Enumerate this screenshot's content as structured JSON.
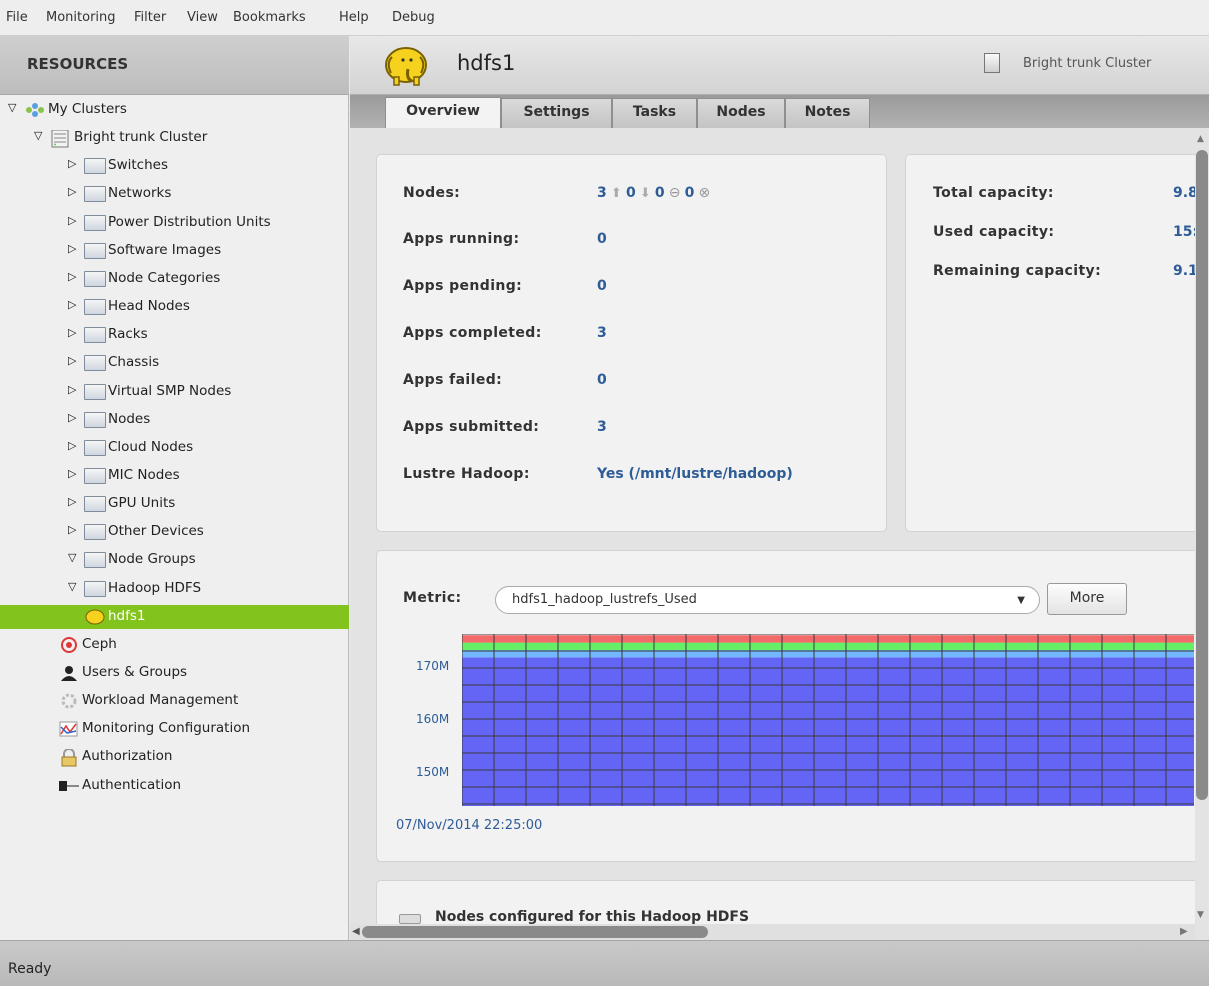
{
  "menu": [
    "File",
    "Monitoring",
    "Filter",
    "View",
    "Bookmarks",
    "Help",
    "Debug"
  ],
  "sidebar": {
    "header": "RESOURCES",
    "tree": [
      {
        "label": "My Clusters",
        "icon": "clusters-icon",
        "toggle": "expanded"
      },
      {
        "label": "Bright trunk Cluster",
        "icon": "cluster-icon",
        "toggle": "expanded"
      },
      {
        "label": "Switches",
        "icon": "folder-icon",
        "toggle": "collapsed"
      },
      {
        "label": "Networks",
        "icon": "folder-icon",
        "toggle": "collapsed"
      },
      {
        "label": "Power Distribution Units",
        "icon": "folder-icon",
        "toggle": "collapsed"
      },
      {
        "label": "Software Images",
        "icon": "folder-icon",
        "toggle": "collapsed"
      },
      {
        "label": "Node Categories",
        "icon": "folder-icon",
        "toggle": "collapsed"
      },
      {
        "label": "Head Nodes",
        "icon": "folder-icon",
        "toggle": "collapsed"
      },
      {
        "label": "Racks",
        "icon": "folder-icon",
        "toggle": "collapsed"
      },
      {
        "label": "Chassis",
        "icon": "folder-icon",
        "toggle": "collapsed"
      },
      {
        "label": "Virtual SMP Nodes",
        "icon": "folder-icon",
        "toggle": "collapsed"
      },
      {
        "label": "Nodes",
        "icon": "folder-icon",
        "toggle": "collapsed"
      },
      {
        "label": "Cloud Nodes",
        "icon": "folder-icon",
        "toggle": "collapsed"
      },
      {
        "label": "MIC Nodes",
        "icon": "folder-icon",
        "toggle": "collapsed"
      },
      {
        "label": "GPU Units",
        "icon": "folder-icon",
        "toggle": "collapsed"
      },
      {
        "label": "Other Devices",
        "icon": "folder-icon",
        "toggle": "collapsed"
      },
      {
        "label": "Node Groups",
        "icon": "folder-icon",
        "toggle": "expanded"
      },
      {
        "label": "Hadoop HDFS",
        "icon": "folder-icon",
        "toggle": "expanded"
      },
      {
        "label": "hdfs1",
        "icon": "hadoop-elephant-icon",
        "toggle": "none",
        "selected": true
      },
      {
        "label": "Ceph",
        "icon": "ceph-icon",
        "toggle": "none"
      },
      {
        "label": "Users & Groups",
        "icon": "user-icon",
        "toggle": "none"
      },
      {
        "label": "Workload Management",
        "icon": "gear-icon",
        "toggle": "none"
      },
      {
        "label": "Monitoring Configuration",
        "icon": "monitoring-chart-icon",
        "toggle": "none"
      },
      {
        "label": "Authorization",
        "icon": "lock-icon",
        "toggle": "none"
      },
      {
        "label": "Authentication",
        "icon": "key-icon",
        "toggle": "none"
      }
    ]
  },
  "header": {
    "title": "hdfs1",
    "cluster_label": "Bright trunk Cluster"
  },
  "tabs": [
    {
      "label": "Overview",
      "active": true
    },
    {
      "label": "Settings",
      "active": false
    },
    {
      "label": "Tasks",
      "active": false
    },
    {
      "label": "Nodes",
      "active": false
    },
    {
      "label": "Notes",
      "active": false
    }
  ],
  "overview": {
    "nodes_label": "Nodes:",
    "nodes_up": "3",
    "nodes_down": "0",
    "nodes_closed": "0",
    "nodes_failed": "0",
    "rows": [
      {
        "label": "Apps running:",
        "value": "0"
      },
      {
        "label": "Apps pending:",
        "value": "0"
      },
      {
        "label": "Apps completed:",
        "value": "3"
      },
      {
        "label": "Apps failed:",
        "value": "0"
      },
      {
        "label": "Apps submitted:",
        "value": "3"
      },
      {
        "label": "Lustre Hadoop:",
        "value": "Yes (/mnt/lustre/hadoop)"
      }
    ],
    "capacity": [
      {
        "label": "Total capacity:",
        "value": "9.8"
      },
      {
        "label": "Used capacity:",
        "value": "15:"
      },
      {
        "label": "Remaining capacity:",
        "value": "9.1"
      }
    ]
  },
  "metric": {
    "label": "Metric:",
    "selected": "hdfs1_hadoop_lustrefs_Used",
    "more_label": "More",
    "timestamp": "07/Nov/2014 22:25:00"
  },
  "nodes_section_title": "Nodes configured for this Hadoop HDFS",
  "status": "Ready",
  "chart_data": {
    "type": "area",
    "ylabel": "",
    "yticks": [
      "170M",
      "160M",
      "150M"
    ],
    "ylim": [
      145,
      173
    ],
    "series": [
      {
        "color": "#6565f5",
        "values": [
          169.2
        ]
      },
      {
        "color": "#73b7ff",
        "values": [
          1.2
        ]
      },
      {
        "color": "#66ee66",
        "values": [
          1.2
        ]
      },
      {
        "color": "#f26a6a",
        "values": [
          1.2
        ]
      }
    ]
  }
}
